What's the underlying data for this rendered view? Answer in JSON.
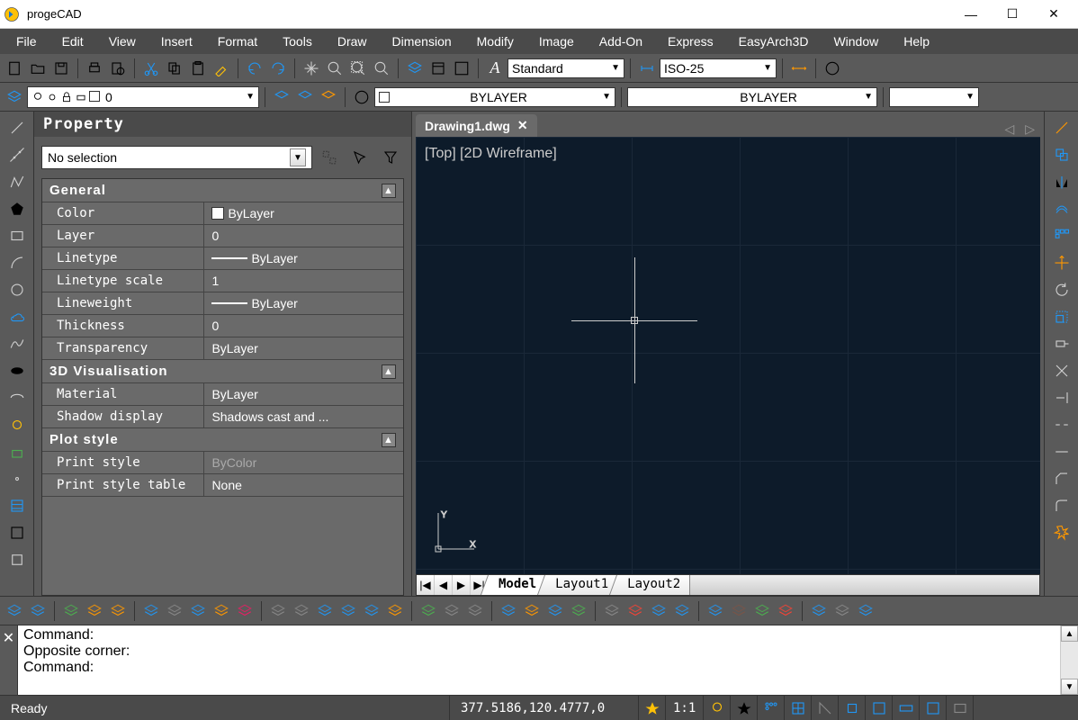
{
  "app": {
    "title": "progeCAD"
  },
  "menu": [
    "File",
    "Edit",
    "View",
    "Insert",
    "Format",
    "Tools",
    "Draw",
    "Dimension",
    "Modify",
    "Image",
    "Add-On",
    "Express",
    "EasyArch3D",
    "Window",
    "Help"
  ],
  "toolbar1": {
    "text_style": "Standard",
    "dim_style": "ISO-25"
  },
  "toolbar2": {
    "layer": "0",
    "color_combo": "BYLAYER",
    "linetype_combo": "BYLAYER"
  },
  "property": {
    "title": "Property",
    "selection": "No selection",
    "groups": [
      {
        "name": "General",
        "rows": [
          {
            "label": "Color",
            "value": "ByLayer",
            "swatch": true
          },
          {
            "label": "Layer",
            "value": "0"
          },
          {
            "label": "Linetype",
            "value": "ByLayer",
            "line": true
          },
          {
            "label": "Linetype scale",
            "value": "1"
          },
          {
            "label": "Lineweight",
            "value": "ByLayer",
            "line": true
          },
          {
            "label": "Thickness",
            "value": "0"
          },
          {
            "label": "Transparency",
            "value": "ByLayer"
          }
        ]
      },
      {
        "name": "3D Visualisation",
        "rows": [
          {
            "label": "Material",
            "value": "ByLayer"
          },
          {
            "label": "Shadow display",
            "value": "Shadows cast and ..."
          }
        ]
      },
      {
        "name": "Plot style",
        "rows": [
          {
            "label": "Print style",
            "value": "ByColor",
            "dim": true
          },
          {
            "label": "Print style table",
            "value": "None"
          }
        ]
      }
    ]
  },
  "drawing": {
    "tab": "Drawing1.dwg",
    "viewlabel": "[Top] [2D Wireframe]",
    "layouts": [
      "Model",
      "Layout1",
      "Layout2"
    ],
    "active_layout": "Model"
  },
  "command": {
    "lines": [
      "Command:",
      "Opposite corner:",
      "Command:"
    ]
  },
  "status": {
    "ready": "Ready",
    "coords": "377.5186,120.4777,0",
    "ratio": "1:1"
  }
}
